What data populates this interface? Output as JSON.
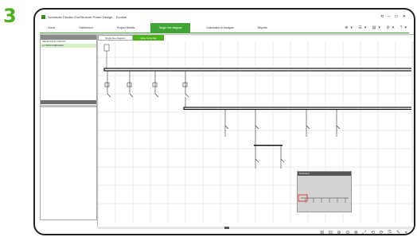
{
  "step_number": "3",
  "window": {
    "title": "Schneider Electric EcoStruxure Power Design – Ecodial",
    "controls": "⟲ – ▭ ✕"
  },
  "menu": {
    "items": [
      {
        "label": "Home"
      },
      {
        "label": "Distribution"
      },
      {
        "label": "Project Details"
      },
      {
        "label": "Single line diagram",
        "active": true
      },
      {
        "label": "Calculation & Analysis"
      },
      {
        "label": "Reports"
      }
    ],
    "tools": "⊕▾ ☰▾ ▤▾ ⚙▾ ?▾"
  },
  "left_panel": {
    "rows": [
      {
        "label": "SELECTION CIRCUIT",
        "selected": false
      },
      {
        "label": "LV SWITCHBOARD",
        "selected": true
      }
    ]
  },
  "diagram": {
    "tabs": [
      {
        "label": "Single line diagram",
        "active": false
      },
      {
        "label": "Cable Schedule",
        "active": true
      }
    ]
  },
  "minimap": {
    "title": "Overview"
  },
  "statusbar": {
    "tools": "⊞ ⊟ ⊕ ⊖ ⊗ ⤢ ⟲ ⟳ ⎘ ✎ ⌖"
  },
  "accent_color": "#3fa535",
  "step_color": "#4caf1c"
}
